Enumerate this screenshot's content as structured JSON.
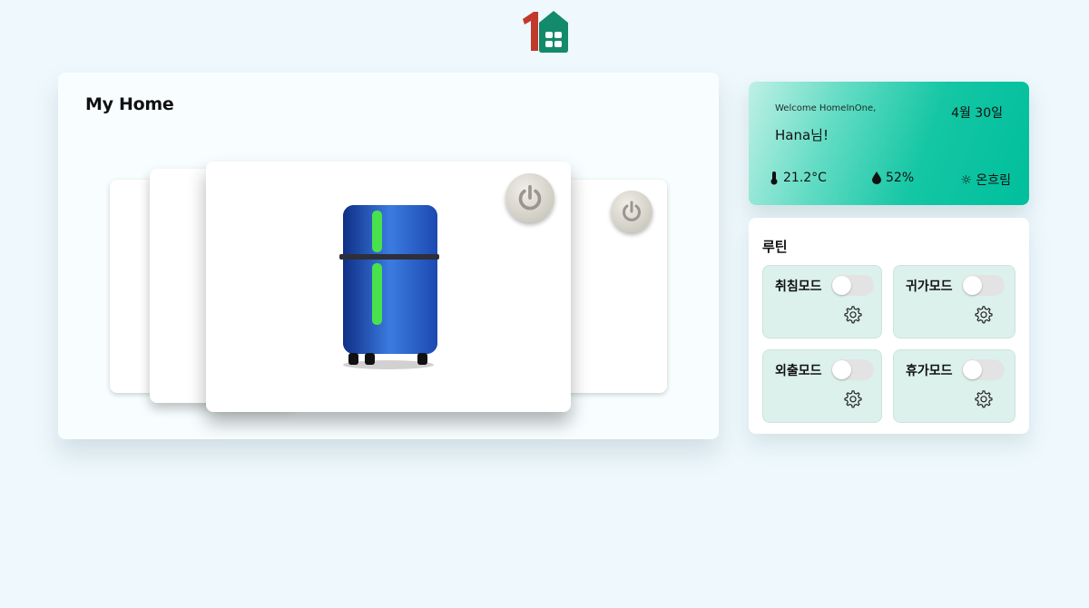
{
  "header": {
    "logo_icon": "home-in-one-logo",
    "brand_colors": [
      "#c0392b",
      "#138a6b"
    ]
  },
  "home": {
    "title": "My Home",
    "carousel": {
      "selected_device_icon": "refrigerator-icon",
      "power_icon": "power-icon"
    }
  },
  "welcome": {
    "greeting": "Welcome HomeInOne,",
    "date": "4월 30일",
    "user": "Hana님!",
    "temperature": "21.2°C",
    "humidity": "52%",
    "condition": "☼ 온흐림",
    "icons": {
      "temperature": "thermometer-icon",
      "humidity": "droplet-icon"
    },
    "gradient_colors": [
      "#bff0e6",
      "#00bf9c"
    ]
  },
  "routine": {
    "title": "루틴",
    "modes": [
      {
        "label": "취침모드",
        "enabled": false
      },
      {
        "label": "귀가모드",
        "enabled": false
      },
      {
        "label": "외출모드",
        "enabled": false
      },
      {
        "label": "휴가모드",
        "enabled": false
      }
    ],
    "settings_icon": "gear-icon",
    "card_color": "#dcf1ec"
  }
}
